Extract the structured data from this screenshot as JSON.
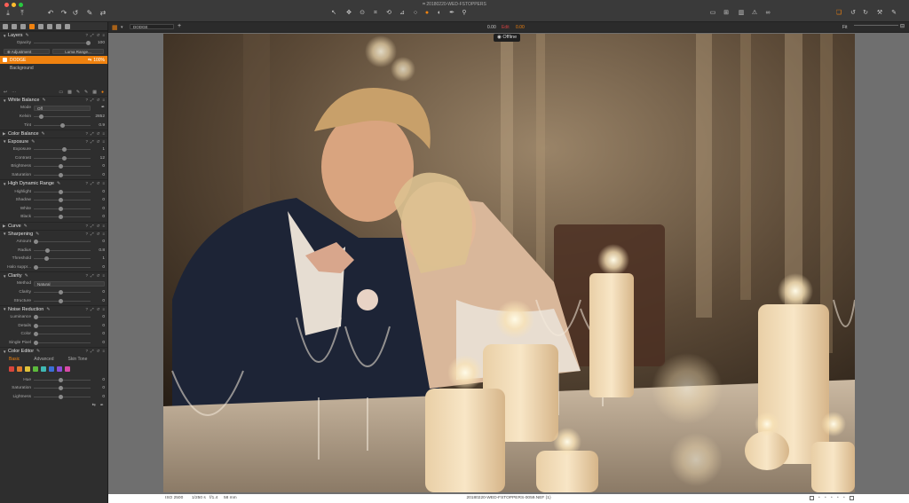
{
  "window": {
    "title": "20180220-WED-FSTOPPERS"
  },
  "viewer_toolbar": {
    "layer_name": "DODGE",
    "readout_1": "0.00",
    "readout_label": "Edit",
    "readout_2": "0.00",
    "fit_label": "Fit"
  },
  "offline_badge": "Offline",
  "layers": {
    "title": "Layers",
    "opacity_label": "Opacity",
    "opacity_value": "100",
    "opacity_level": 1.0,
    "adjustment_label": "Adjustment",
    "luma_label": "Luma Range...",
    "items": [
      {
        "name": "DODGE",
        "value": "100%"
      },
      {
        "name": "Background"
      }
    ]
  },
  "white_balance": {
    "title": "White Balance",
    "mode_label": "Mode",
    "mode_value": "Off",
    "kelvin_label": "Kelvin",
    "kelvin_value": "2852",
    "kelvin_level": 0.1,
    "tint_label": "Tint",
    "tint_value": "0.9",
    "tint_level": 0.5
  },
  "color_balance": {
    "title": "Color Balance"
  },
  "exposure": {
    "title": "Exposure",
    "rows": [
      {
        "label": "Exposure",
        "value": "1",
        "level": 0.55
      },
      {
        "label": "Contrast",
        "value": "12",
        "level": 0.55
      },
      {
        "label": "Brightness",
        "value": "0",
        "level": 0.47
      },
      {
        "label": "Saturation",
        "value": "0",
        "level": 0.47
      }
    ]
  },
  "hdr": {
    "title": "High Dynamic Range",
    "rows": [
      {
        "label": "Highlight",
        "value": "0",
        "level": 0.47
      },
      {
        "label": "Shadow",
        "value": "0",
        "level": 0.47
      },
      {
        "label": "White",
        "value": "0",
        "level": 0.47
      },
      {
        "label": "Black",
        "value": "0",
        "level": 0.47
      }
    ]
  },
  "curve": {
    "title": "Curve"
  },
  "sharpening": {
    "title": "Sharpening",
    "rows": [
      {
        "label": "Amount",
        "value": "0",
        "level": 0.0
      },
      {
        "label": "Radius",
        "value": "0.8",
        "level": 0.22
      },
      {
        "label": "Threshold",
        "value": "1",
        "level": 0.2
      },
      {
        "label": "Halo suppr...",
        "value": "0",
        "level": 0.0
      }
    ]
  },
  "clarity": {
    "title": "Clarity",
    "method_label": "Method",
    "method_value": "Natural",
    "rows": [
      {
        "label": "Clarity",
        "value": "0",
        "level": 0.47
      },
      {
        "label": "Structure",
        "value": "0",
        "level": 0.47
      }
    ]
  },
  "noise_reduction": {
    "title": "Noise Reduction",
    "rows": [
      {
        "label": "Luminance",
        "value": "0",
        "level": 0.0
      },
      {
        "label": "Details",
        "value": "0",
        "level": 0.0
      },
      {
        "label": "Color",
        "value": "0",
        "level": 0.0
      },
      {
        "label": "Single Pixel",
        "value": "0",
        "level": 0.0
      }
    ]
  },
  "color_editor": {
    "title": "Color Editor",
    "tabs": [
      "Basic",
      "Advanced",
      "Skin Tone"
    ],
    "swatches": [
      "#d8453c",
      "#e07a2c",
      "#e0c23a",
      "#5cba3c",
      "#3fb8b3",
      "#3a6fd8",
      "#8c4ed8",
      "#d84aa9"
    ],
    "rows": [
      {
        "label": "Hue",
        "value": "0",
        "level": 0.47
      },
      {
        "label": "Saturation",
        "value": "0",
        "level": 0.47
      },
      {
        "label": "Lightness",
        "value": "0",
        "level": 0.47
      }
    ]
  },
  "status": {
    "iso": "ISO 2500",
    "shutter": "1/250 s",
    "aperture": "f/1.4",
    "focal": "58 mm",
    "filename": "20180220-WED-FSTOPPERS-0059.NEF (1)"
  },
  "colors": {
    "accent": "#f0820f",
    "panel": "#2e2e2e",
    "toolbar": "#3a3a3a",
    "viewer_bg": "#6f6f6f"
  }
}
